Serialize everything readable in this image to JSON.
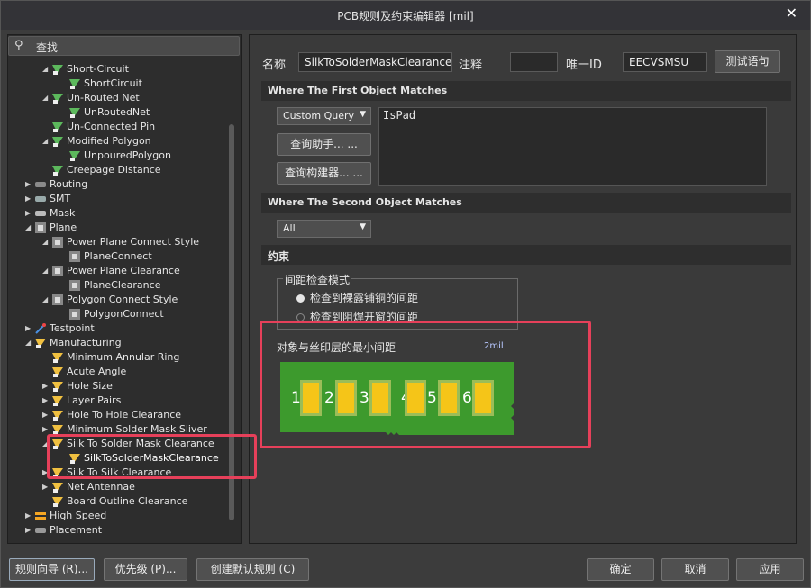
{
  "window": {
    "title": "PCB规则及约束编辑器 [mil]",
    "close": "✕"
  },
  "search": {
    "label": "查找",
    "icon": "search-icon"
  },
  "tree": [
    {
      "label": "Short-Circuit",
      "depth": 2,
      "expand": "down",
      "icon": "rule"
    },
    {
      "label": "ShortCircuit",
      "depth": 3,
      "expand": "",
      "icon": "rule"
    },
    {
      "label": "Un-Routed Net",
      "depth": 2,
      "expand": "down",
      "icon": "rule"
    },
    {
      "label": "UnRoutedNet",
      "depth": 3,
      "expand": "",
      "icon": "rule"
    },
    {
      "label": "Un-Connected Pin",
      "depth": 2,
      "expand": "",
      "icon": "rule"
    },
    {
      "label": "Modified Polygon",
      "depth": 2,
      "expand": "down",
      "icon": "rule"
    },
    {
      "label": "UnpouredPolygon",
      "depth": 3,
      "expand": "",
      "icon": "rule"
    },
    {
      "label": "Creepage Distance",
      "depth": 2,
      "expand": "",
      "icon": "rule"
    },
    {
      "label": "Routing",
      "depth": 1,
      "expand": "right",
      "icon": "routing"
    },
    {
      "label": "SMT",
      "depth": 1,
      "expand": "right",
      "icon": "smt"
    },
    {
      "label": "Mask",
      "depth": 1,
      "expand": "right",
      "icon": "mask"
    },
    {
      "label": "Plane",
      "depth": 1,
      "expand": "down",
      "icon": "plane"
    },
    {
      "label": "Power Plane Connect Style",
      "depth": 2,
      "expand": "down",
      "icon": "plane"
    },
    {
      "label": "PlaneConnect",
      "depth": 3,
      "expand": "",
      "icon": "plane"
    },
    {
      "label": "Power Plane Clearance",
      "depth": 2,
      "expand": "down",
      "icon": "plane"
    },
    {
      "label": "PlaneClearance",
      "depth": 3,
      "expand": "",
      "icon": "plane"
    },
    {
      "label": "Polygon Connect Style",
      "depth": 2,
      "expand": "down",
      "icon": "plane"
    },
    {
      "label": "PolygonConnect",
      "depth": 3,
      "expand": "",
      "icon": "plane"
    },
    {
      "label": "Testpoint",
      "depth": 1,
      "expand": "right",
      "icon": "testpoint"
    },
    {
      "label": "Manufacturing",
      "depth": 1,
      "expand": "down",
      "icon": "mfg"
    },
    {
      "label": "Minimum Annular Ring",
      "depth": 2,
      "expand": "",
      "icon": "mfg"
    },
    {
      "label": "Acute Angle",
      "depth": 2,
      "expand": "",
      "icon": "mfg"
    },
    {
      "label": "Hole Size",
      "depth": 2,
      "expand": "right",
      "icon": "mfg"
    },
    {
      "label": "Layer Pairs",
      "depth": 2,
      "expand": "right",
      "icon": "mfg"
    },
    {
      "label": "Hole To Hole Clearance",
      "depth": 2,
      "expand": "right",
      "icon": "mfg"
    },
    {
      "label": "Minimum Solder Mask Sliver",
      "depth": 2,
      "expand": "right",
      "icon": "mfg"
    },
    {
      "label": "Silk To Solder Mask Clearance",
      "depth": 2,
      "expand": "down",
      "icon": "mfg"
    },
    {
      "label": "SilkToSolderMaskClearance",
      "depth": 3,
      "expand": "",
      "icon": "mfg",
      "selected": true
    },
    {
      "label": "Silk To Silk Clearance",
      "depth": 2,
      "expand": "right",
      "icon": "mfg"
    },
    {
      "label": "Net Antennae",
      "depth": 2,
      "expand": "right",
      "icon": "mfg"
    },
    {
      "label": "Board Outline Clearance",
      "depth": 2,
      "expand": "",
      "icon": "mfg"
    },
    {
      "label": "High Speed",
      "depth": 1,
      "expand": "right",
      "icon": "highspeed"
    },
    {
      "label": "Placement",
      "depth": 1,
      "expand": "right",
      "icon": "placement"
    }
  ],
  "rule": {
    "name_label": "名称",
    "name_value": "SilkToSolderMaskClearance",
    "comment_label": "注释",
    "comment_value": "",
    "id_label": "唯一ID",
    "id_value": "EECVSMSU",
    "test_button": "测试语句"
  },
  "first_match": {
    "header": "Where The First Object Matches",
    "selected": "Custom Query",
    "helper_button": "查询助手... ...",
    "builder_button": "查询构建器... ...",
    "query_text": "IsPad"
  },
  "second_match": {
    "header": "Where The Second Object Matches",
    "selected": "All"
  },
  "constraints": {
    "header": "约束",
    "group_title": "间距检查模式",
    "option1": "检查到裸露铺铜的间距",
    "option2": "检查到阻焊开窗的间距",
    "min_label": "对象与丝印层的最小间距",
    "min_value": "2mil",
    "pads": [
      "1",
      "2",
      "3",
      "4",
      "5",
      "6"
    ]
  },
  "footer": {
    "wizard": "规则向导 (R)...",
    "priority": "优先级 (P)...",
    "create_default": "创建默认规则 (C)",
    "ok": "确定",
    "cancel": "取消",
    "apply": "应用"
  },
  "colors": {
    "highlight": "#e6405a",
    "board": "#3d9a2d",
    "pad": "#f5c518"
  }
}
